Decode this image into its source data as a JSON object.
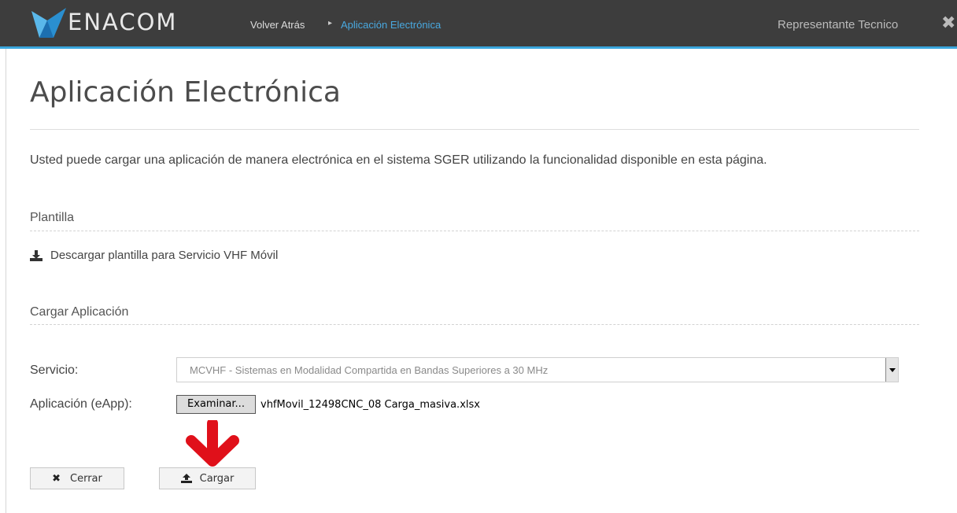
{
  "header": {
    "brand": "ENACOM",
    "breadcrumb_back": "Volver Atrás",
    "breadcrumb_separator": "▸",
    "breadcrumb_current": "Aplicación Electrónica",
    "user_role": "Representante Tecnico",
    "close_glyph": "✖"
  },
  "page": {
    "title": "Aplicación Electrónica",
    "intro": "Usted puede cargar una aplicación de manera electrónica en el sistema SGER utilizando la funcionalidad disponible en esta página."
  },
  "plantilla": {
    "heading": "Plantilla",
    "download_link": "Descargar plantilla para Servicio VHF Móvil"
  },
  "cargar": {
    "heading": "Cargar Aplicación",
    "servicio_label": "Servicio:",
    "servicio_value": "MCVHF - Sistemas en Modalidad Compartida en Bandas Superiores a 30 MHz",
    "aplicacion_label": "Aplicación (eApp):",
    "browse_button": "Examinar...",
    "file_name": "vhfMovil_12498CNC_08 Carga_masiva.xlsx"
  },
  "actions": {
    "cerrar_label": "Cerrar",
    "cerrar_icon": "✖",
    "cargar_label": "Cargar"
  },
  "colors": {
    "header_bg": "#3d3d3d",
    "accent_blue": "#3aa6dd",
    "arrow_red": "#e0101a"
  }
}
